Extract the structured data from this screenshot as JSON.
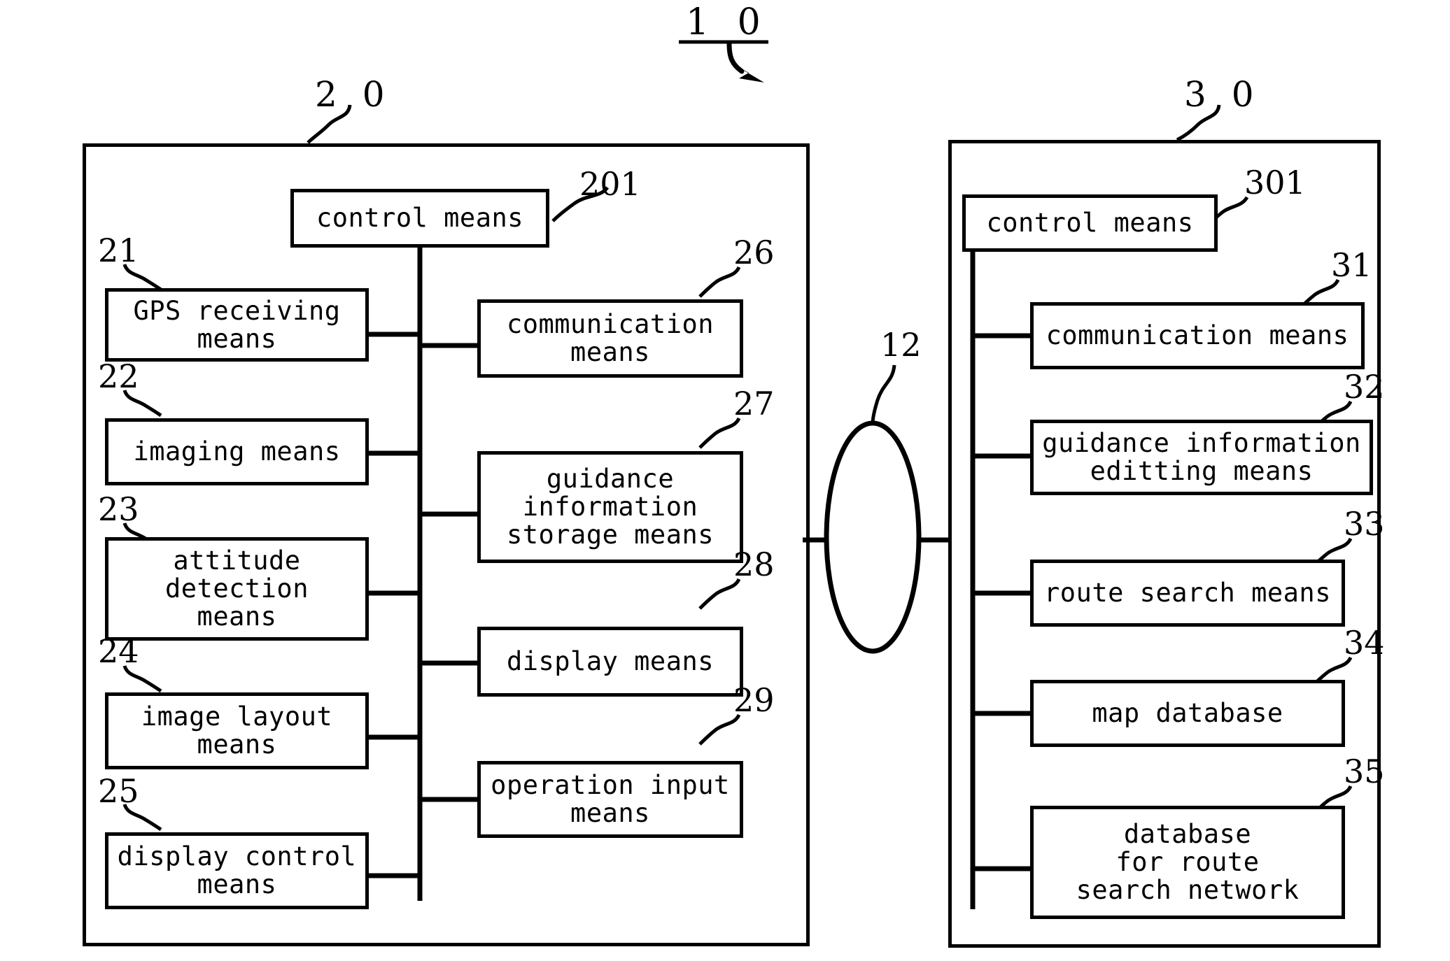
{
  "figure": {
    "system_ref": "1 0",
    "terminal_ref": "2 0",
    "server_ref": "3 0",
    "network_ref": "12"
  },
  "terminal": {
    "ref": "2 0",
    "control": {
      "ref": "201",
      "label": "control means"
    },
    "left_column": [
      {
        "ref": "21",
        "label": "GPS receiving\nmeans"
      },
      {
        "ref": "22",
        "label": "imaging means"
      },
      {
        "ref": "23",
        "label": "attitude\ndetection\nmeans"
      },
      {
        "ref": "24",
        "label": "image layout\nmeans"
      },
      {
        "ref": "25",
        "label": "display control\nmeans"
      }
    ],
    "right_column": [
      {
        "ref": "26",
        "label": "communication\nmeans"
      },
      {
        "ref": "27",
        "label": "guidance\ninformation\nstorage means"
      },
      {
        "ref": "28",
        "label": "display means"
      },
      {
        "ref": "29",
        "label": "operation input\nmeans"
      }
    ]
  },
  "server": {
    "ref": "3 0",
    "control": {
      "ref": "301",
      "label": "control means"
    },
    "column": [
      {
        "ref": "31",
        "label": "communication means"
      },
      {
        "ref": "32",
        "label": "guidance information\neditting means"
      },
      {
        "ref": "33",
        "label": "route search means"
      },
      {
        "ref": "34",
        "label": "map database"
      },
      {
        "ref": "35",
        "label": "database\nfor route\nsearch network"
      }
    ]
  },
  "network": {
    "ref": "12",
    "shape": "ellipse"
  },
  "colors": {
    "ink": "#000000",
    "paper": "#ffffff"
  }
}
